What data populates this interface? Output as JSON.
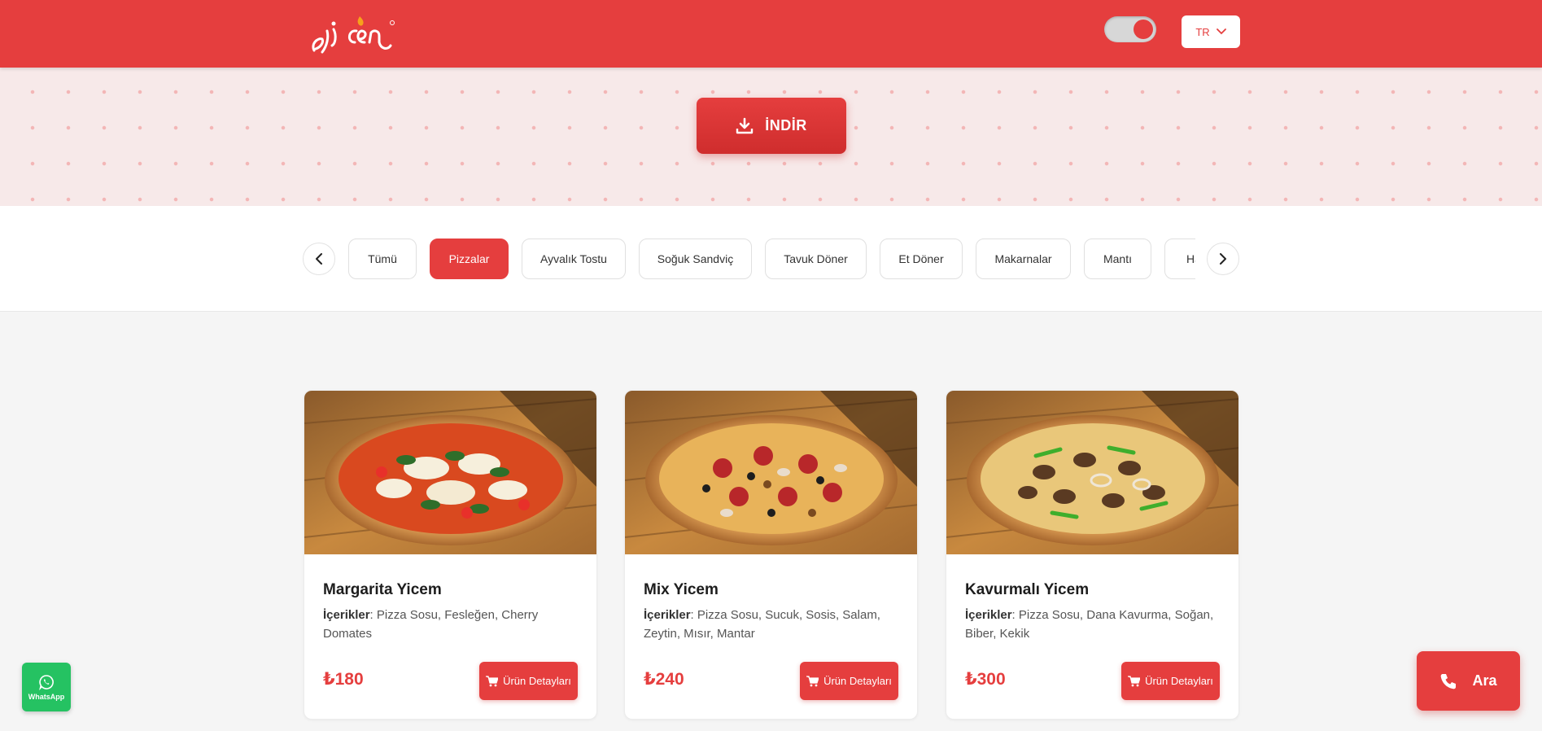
{
  "header": {
    "language": "TR",
    "theme_toggle_on": true
  },
  "hero": {
    "download_label": "İNDİR"
  },
  "categories": {
    "items": [
      "Tümü",
      "Pizzalar",
      "Ayvalık Tostu",
      "Soğuk Sandviç",
      "Tavuk Döner",
      "Et Döner",
      "Makarnalar",
      "Mantı",
      "Ha"
    ],
    "active": "Pizzalar"
  },
  "products": [
    {
      "name": "Margarita Yicem",
      "ingredients_label": "İçerikler",
      "ingredients": ": Pizza Sosu, Fesleğen, Cherry Domates",
      "price": "₺180",
      "button_label": "Ürün Detayları",
      "image": "margarita-pizza-image"
    },
    {
      "name": "Mix Yicem",
      "ingredients_label": "İçerikler",
      "ingredients": ": Pizza Sosu, Sucuk, Sosis, Salam, Zeytin, Mısır, Mantar",
      "price": "₺240",
      "button_label": "Ürün Detayları",
      "image": "mix-pizza-image"
    },
    {
      "name": "Kavurmalı Yicem",
      "ingredients_label": "İçerikler",
      "ingredients": ": Pizza Sosu, Dana Kavurma, Soğan, Biber, Kekik",
      "price": "₺300",
      "button_label": "Ürün Detayları",
      "image": "kavurma-pizza-image"
    }
  ],
  "floating": {
    "whatsapp_label": "WhatsApp",
    "call_label": "Ara"
  },
  "colors": {
    "brand_red": "#e53e3e",
    "whatsapp_green": "#25c262"
  }
}
